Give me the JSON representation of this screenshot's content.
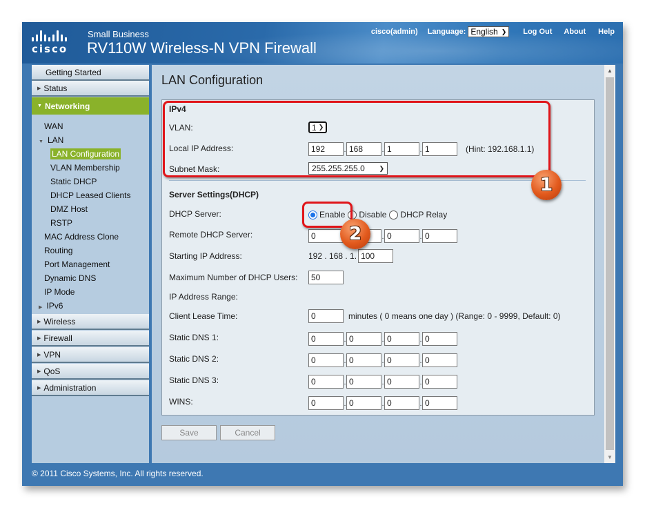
{
  "header": {
    "logo_text": "cisco",
    "brand_small": "Small Business",
    "brand_title": "RV110W Wireless-N VPN Firewall",
    "user": "cisco(admin)",
    "language_label": "Language:",
    "language_value": "English",
    "logout": "Log Out",
    "about": "About",
    "help": "Help"
  },
  "sidebar": {
    "getting_started": "Getting Started",
    "status": "Status",
    "networking": "Networking",
    "networking_items": [
      {
        "label": "WAN"
      },
      {
        "label": "LAN"
      },
      {
        "label": "LAN Configuration",
        "active": true
      },
      {
        "label": "VLAN Membership"
      },
      {
        "label": "Static DHCP"
      },
      {
        "label": "DHCP Leased Clients"
      },
      {
        "label": "DMZ Host"
      },
      {
        "label": "RSTP"
      },
      {
        "label": "MAC Address Clone"
      },
      {
        "label": "Routing"
      },
      {
        "label": "Port Management"
      },
      {
        "label": "Dynamic DNS"
      },
      {
        "label": "IP Mode"
      },
      {
        "label": "IPv6"
      }
    ],
    "sections": [
      "Wireless",
      "Firewall",
      "VPN",
      "QoS",
      "Administration"
    ]
  },
  "main": {
    "title": "LAN Configuration",
    "ipv4": {
      "title": "IPv4",
      "vlan_label": "VLAN:",
      "vlan_value": "1",
      "local_ip_label": "Local IP Address:",
      "local_ip": [
        "192",
        "168",
        "1",
        "1"
      ],
      "local_ip_hint": "(Hint: 192.168.1.1)",
      "subnet_label": "Subnet Mask:",
      "subnet_value": "255.255.255.0"
    },
    "dhcp": {
      "title": "Server Settings(DHCP)",
      "server_label": "DHCP Server:",
      "options": [
        "Enable",
        "Disable",
        "DHCP Relay"
      ],
      "selected": "Enable",
      "remote_label": "Remote DHCP Server:",
      "remote_ip": [
        "0",
        "0",
        "0",
        "0"
      ],
      "start_label": "Starting IP Address:",
      "start_prefix": "192 . 168 . 1.",
      "start_value": "100",
      "max_users_label": "Maximum Number of DHCP Users:",
      "max_users_value": "50",
      "range_label": "IP Address Range:",
      "lease_label": "Client Lease Time:",
      "lease_value": "0",
      "lease_hint": "minutes ( 0 means one day )  (Range: 0 - 9999, Default: 0)",
      "dns1_label": "Static DNS 1:",
      "dns1": [
        "0",
        "0",
        "0",
        "0"
      ],
      "dns2_label": "Static DNS 2:",
      "dns2": [
        "0",
        "0",
        "0",
        "0"
      ],
      "dns3_label": "Static DNS 3:",
      "dns3": [
        "0",
        "0",
        "0",
        "0"
      ],
      "wins_label": "WINS:",
      "wins": [
        "0",
        "0",
        "0",
        "0"
      ]
    },
    "save": "Save",
    "cancel": "Cancel"
  },
  "annotations": {
    "badge1": "1",
    "badge2": "2"
  },
  "footer": "© 2011 Cisco Systems, Inc. All rights reserved.",
  "colors": {
    "accent_green": "#8ab22a",
    "frame_blue": "#3e78b2",
    "annotation_red": "#e0151a"
  }
}
